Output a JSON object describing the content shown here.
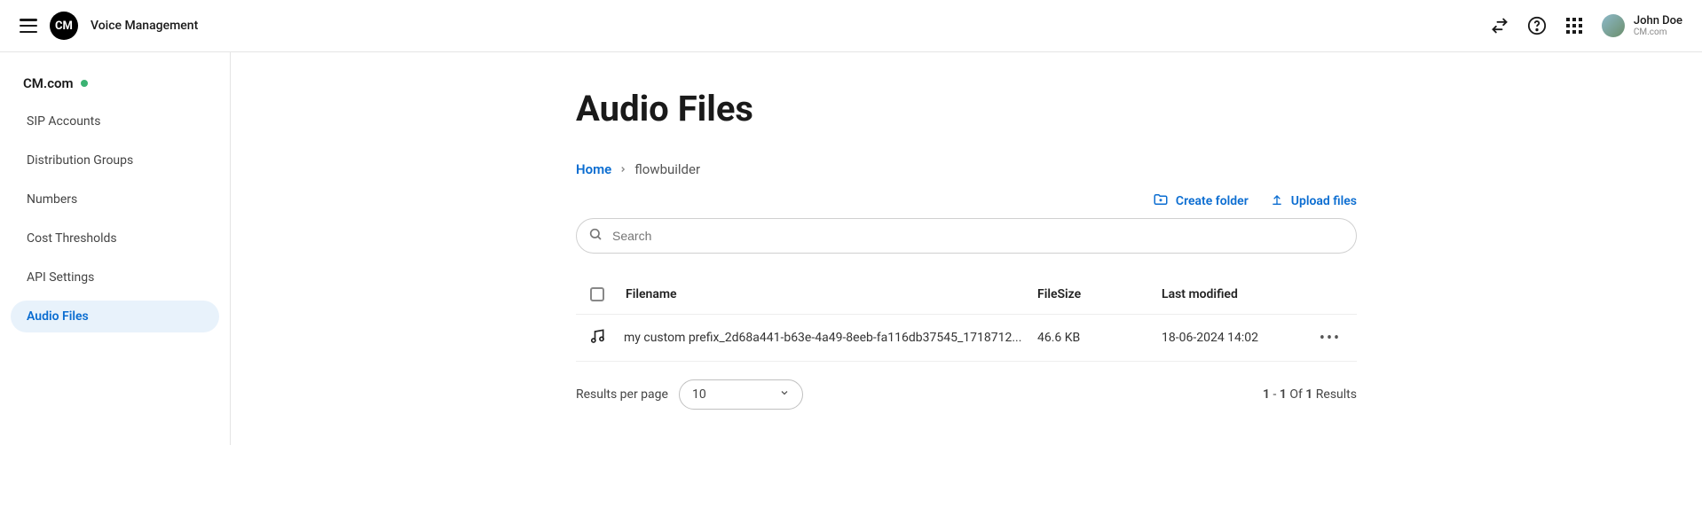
{
  "header": {
    "app_title": "Voice Management",
    "logo_text": "CM",
    "user_name": "John Doe",
    "user_org": "CM.com"
  },
  "sidebar": {
    "org_label": "CM.com",
    "items": [
      {
        "label": "SIP Accounts",
        "active": false
      },
      {
        "label": "Distribution Groups",
        "active": false
      },
      {
        "label": "Numbers",
        "active": false
      },
      {
        "label": "Cost Thresholds",
        "active": false
      },
      {
        "label": "API Settings",
        "active": false
      },
      {
        "label": "Audio Files",
        "active": true
      }
    ]
  },
  "main": {
    "page_title": "Audio Files",
    "breadcrumb": {
      "home_label": "Home",
      "current": "flowbuilder"
    },
    "actions": {
      "create_folder": "Create folder",
      "upload_files": "Upload files"
    },
    "search": {
      "placeholder": "Search"
    },
    "table": {
      "headers": {
        "filename": "Filename",
        "filesize": "FileSize",
        "last_modified": "Last modified"
      },
      "rows": [
        {
          "filename": "my custom prefix_2d68a441-b63e-4a49-8eeb-fa116db37545_1718712...",
          "filesize": "46.6 KB",
          "last_modified": "18-06-2024 14:02"
        }
      ]
    },
    "pagination": {
      "results_per_page_label": "Results per page",
      "per_page_value": "10",
      "range_start": "1",
      "range_end": "1",
      "of_label": "Of",
      "total": "1",
      "results_label": "Results"
    }
  }
}
